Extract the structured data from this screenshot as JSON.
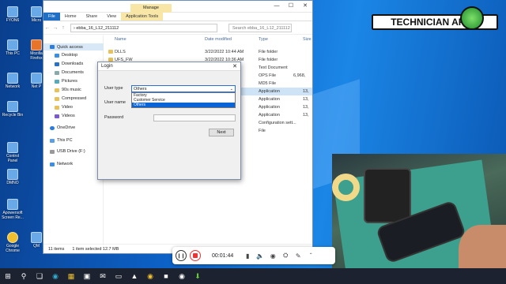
{
  "desktop_icons": [
    {
      "label": "FYON6",
      "icon": "file-icon"
    },
    {
      "label": "Micro",
      "icon": "app-icon"
    },
    {
      "label": "This PC",
      "icon": "pc-icon"
    },
    {
      "label": "Mozilla Firefox",
      "icon": "firefox-icon"
    },
    {
      "label": "Network",
      "icon": "network-icon"
    },
    {
      "label": "Net P",
      "icon": "app-icon"
    },
    {
      "label": "Recycle Bin",
      "icon": "recycle-icon"
    },
    {
      "label": "Control Panel",
      "icon": "control-panel-icon"
    },
    {
      "label": "DMNO",
      "icon": "file-icon"
    },
    {
      "label": "Apowersoft Screen Re...",
      "icon": "app-icon"
    },
    {
      "label": "Google Chrome",
      "icon": "chrome-icon"
    },
    {
      "label": "QM",
      "icon": "app-icon"
    }
  ],
  "explorer": {
    "ribbon_tabs": [
      "File",
      "Home",
      "Share",
      "View",
      "Application Tools"
    ],
    "manage_tab": "Manage",
    "path": "ebba_16_L12_211112",
    "search_placeholder": "Search ebba_16_L12_211112",
    "nav": {
      "quick_access": "Quick access",
      "items": [
        "Desktop",
        "Downloads",
        "Documents",
        "Pictures",
        "90s music",
        "Compressed",
        "Video",
        "Videos"
      ],
      "onedrive": "OneDrive",
      "thispc": "This PC",
      "usb": "USB Drive (F:)",
      "network": "Network"
    },
    "columns": {
      "name": "Name",
      "date": "Date modified",
      "type": "Type",
      "size": "Size"
    },
    "files": [
      {
        "name": "DLLS",
        "date": "3/22/2022 10:44 AM",
        "type": "File folder",
        "size": ""
      },
      {
        "name": "UFS_FW",
        "date": "3/22/2022 10:36 AM",
        "type": "File folder",
        "size": ""
      },
      {
        "name": "",
        "date": "",
        "type": "Text Document",
        "size": ""
      },
      {
        "name": "",
        "date": "",
        "type": "OPS File",
        "size": "6,968,"
      },
      {
        "name": "",
        "date": "",
        "type": "MD5 File",
        "size": ""
      },
      {
        "name": "",
        "date": "",
        "type": "Application",
        "size": "13,"
      },
      {
        "name": "",
        "date": "",
        "type": "Application",
        "size": "13,"
      },
      {
        "name": "",
        "date": "",
        "type": "Application",
        "size": "13,"
      },
      {
        "name": "",
        "date": "",
        "type": "Application",
        "size": "13,"
      },
      {
        "name": "",
        "date": "",
        "type": "Configuration sett...",
        "size": ""
      },
      {
        "name": "",
        "date": "",
        "type": "File",
        "size": ""
      }
    ],
    "status_items": "11 items",
    "status_selected": "1 item selected  12.7 MB"
  },
  "login": {
    "title": "Login",
    "user_type_label": "User type",
    "user_type_value": "Others",
    "options": [
      "Factory",
      "Customer Service",
      "Others"
    ],
    "user_name_label": "User name",
    "password_label": "Password",
    "next_label": "Next"
  },
  "recorder": {
    "time": "00:01:44"
  },
  "brand": "TECHNICIAN ARUN"
}
